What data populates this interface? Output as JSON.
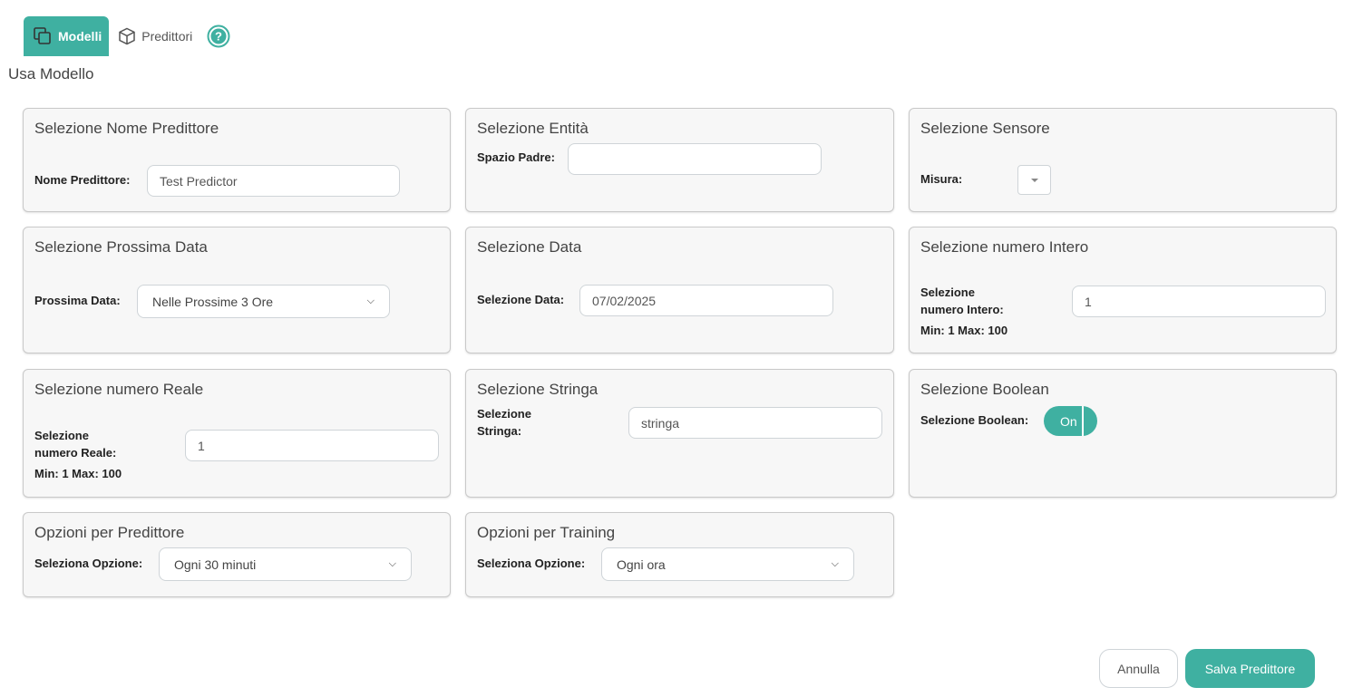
{
  "tabs": [
    {
      "label": "Modelli",
      "icon": "copy-icon",
      "active": true
    },
    {
      "label": "Predittori",
      "icon": "cube-icon",
      "active": false
    }
  ],
  "help_icon": "help-icon",
  "page_title": "Usa Modello",
  "cards": {
    "nome_predittore": {
      "title": "Selezione Nome Predittore",
      "label": "Nome Predittore:",
      "value": "Test Predictor"
    },
    "entita": {
      "title": "Selezione Entità",
      "label": "Spazio Padre:",
      "value": ""
    },
    "sensore": {
      "title": "Selezione Sensore",
      "label": "Misura:"
    },
    "prossima_data": {
      "title": "Selezione Prossima Data",
      "label": "Prossima Data:",
      "selected": "Nelle Prossime 3 Ore"
    },
    "data": {
      "title": "Selezione Data",
      "label": "Selezione Data:",
      "value": "07/02/2025"
    },
    "intero": {
      "title": "Selezione numero Intero",
      "label_line1": "Selezione",
      "label_line2": "numero Intero:",
      "range": "Min: 1 Max: 100",
      "value": "1"
    },
    "reale": {
      "title": "Selezione numero Reale",
      "label_line1": "Selezione",
      "label_line2": "numero Reale:",
      "range": "Min: 1 Max: 100",
      "value": "1"
    },
    "stringa": {
      "title": "Selezione Stringa",
      "label_line1": "Selezione",
      "label_line2": "Stringa:",
      "value": "stringa"
    },
    "boolean": {
      "title": "Selezione Boolean",
      "label": "Selezione Boolean:",
      "toggle_label": "On",
      "on": true
    },
    "opzioni_predittore": {
      "title": "Opzioni per Predittore",
      "label": "Seleziona Opzione:",
      "selected": "Ogni 30 minuti"
    },
    "opzioni_training": {
      "title": "Opzioni per Training",
      "label": "Seleziona Opzione:",
      "selected": "Ogni ora"
    }
  },
  "buttons": {
    "cancel": "Annulla",
    "save": "Salva Predittore"
  },
  "colors": {
    "accent": "#3fb0a1",
    "card_bg": "#f7f7f7",
    "border": "#c9c9c9"
  }
}
